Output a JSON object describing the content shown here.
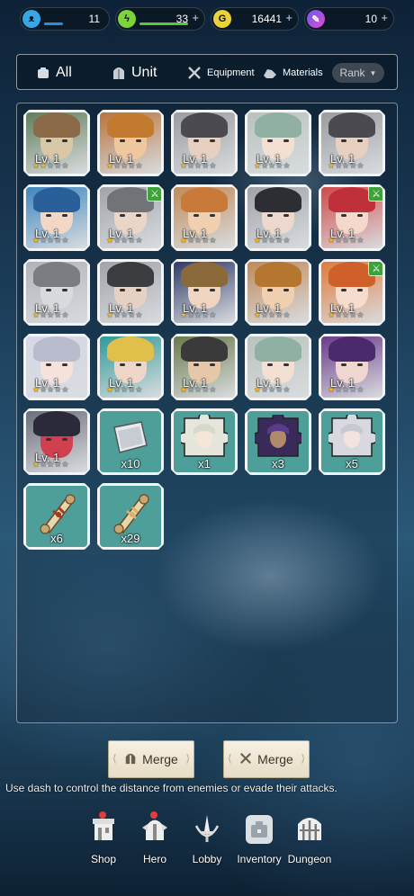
{
  "resources": [
    {
      "name": "stamina",
      "icon": "bear-icon",
      "value": "11",
      "color": "#37a6e6",
      "fill": 0.35
    },
    {
      "name": "energy",
      "icon": "lightning-icon",
      "value": "33",
      "plus": "+",
      "color": "#7dd33a",
      "fill": 0.9
    },
    {
      "name": "gold",
      "icon": "gold-coin-icon",
      "icon_letter": "G",
      "value": "16441",
      "plus": "+",
      "color": "#e8d33a"
    },
    {
      "name": "crystal",
      "icon": "feather-icon",
      "value": "10",
      "plus": "+",
      "color": "#c04de6"
    }
  ],
  "filters": {
    "all": "All",
    "unit": "Unit",
    "equipment": "Equipment",
    "materials": "Materials",
    "rank": "Rank"
  },
  "items": [
    {
      "kind": "unit",
      "lv": "Lv. 1",
      "stars": 2,
      "palette": [
        "#5f7f5a",
        "#d8c8a8",
        "#8b6a4a"
      ]
    },
    {
      "kind": "unit",
      "lv": "Lv. 1",
      "stars": 1,
      "palette": [
        "#b8743c",
        "#f0c8a0",
        "#c27a2e"
      ]
    },
    {
      "kind": "unit",
      "lv": "Lv. 1",
      "stars": 1,
      "palette": [
        "#9a9ca0",
        "#e8d0c0",
        "#4a4a50"
      ]
    },
    {
      "kind": "unit",
      "lv": "Lv. 1",
      "stars": 1,
      "palette": [
        "#b9c2bd",
        "#f3e0d2",
        "#8fb0a2"
      ]
    },
    {
      "kind": "unit",
      "lv": "Lv. 1",
      "stars": 1,
      "palette": [
        "#9a9ca0",
        "#e8d0c0",
        "#4a4a50"
      ]
    },
    {
      "kind": "unit",
      "lv": "Lv. 1",
      "stars": 1,
      "palette": [
        "#3e86c0",
        "#f2d6c6",
        "#2a5f9a"
      ]
    },
    {
      "kind": "unit",
      "lv": "Lv. 1",
      "stars": 1,
      "badge": true,
      "palette": [
        "#a0a3a8",
        "#ead6c8",
        "#707378"
      ]
    },
    {
      "kind": "unit",
      "lv": "Lv. 1",
      "stars": 1,
      "palette": [
        "#c08a5a",
        "#f0d0b0",
        "#c97a3a"
      ]
    },
    {
      "kind": "unit",
      "lv": "Lv. 1",
      "stars": 1,
      "palette": [
        "#9fa3a8",
        "#ecd8cc",
        "#2d2e33"
      ]
    },
    {
      "kind": "unit",
      "lv": "Lv. 1",
      "stars": 1,
      "badge": true,
      "palette": [
        "#d04a4a",
        "#f5d8cc",
        "#c0303a"
      ]
    },
    {
      "kind": "unit",
      "lv": "Lv. 1",
      "stars": 1,
      "palette": [
        "#b0b3b8",
        "#d8dade",
        "#7a7d82"
      ]
    },
    {
      "kind": "unit",
      "lv": "Lv. 1",
      "stars": 1,
      "palette": [
        "#a0a3a8",
        "#e6d2c4",
        "#3b3c40"
      ]
    },
    {
      "kind": "unit",
      "lv": "Lv. 1",
      "stars": 1,
      "palette": [
        "#2e3a6a",
        "#f0d6c0",
        "#8a6a3a"
      ]
    },
    {
      "kind": "unit",
      "lv": "Lv. 1",
      "stars": 1,
      "palette": [
        "#c08a5a",
        "#f0d0b0",
        "#b5762f"
      ]
    },
    {
      "kind": "unit",
      "lv": "Lv. 1",
      "stars": 1,
      "badge": true,
      "palette": [
        "#e07a3a",
        "#f5dccc",
        "#d0602a"
      ]
    },
    {
      "kind": "unit",
      "lv": "Lv. 1",
      "stars": 1,
      "palette": [
        "#d6d8e6",
        "#f5e2dc",
        "#b8bccc"
      ]
    },
    {
      "kind": "unit",
      "lv": "Lv. 1",
      "stars": 1,
      "palette": [
        "#2f9a9a",
        "#f0d6c8",
        "#e0c04a"
      ]
    },
    {
      "kind": "unit",
      "lv": "Lv. 1",
      "stars": 1,
      "palette": [
        "#6a7a4a",
        "#e6c8a8",
        "#3a3a3a"
      ]
    },
    {
      "kind": "unit",
      "lv": "Lv. 1",
      "stars": 1,
      "palette": [
        "#b9c2bd",
        "#f3e0d2",
        "#8fb0a2"
      ]
    },
    {
      "kind": "unit",
      "lv": "Lv. 1",
      "stars": 1,
      "palette": [
        "#6a3a8a",
        "#f0d6d0",
        "#4a2a6a"
      ]
    },
    {
      "kind": "unit",
      "lv": "Lv. 1",
      "stars": 1,
      "palette": [
        "#6a6e78",
        "#d04050",
        "#2a2a3a"
      ]
    },
    {
      "kind": "material",
      "qty": "x10",
      "icon": "metal-plate-icon"
    },
    {
      "kind": "material",
      "qty": "x1",
      "icon": "puzzle-piece-icon",
      "palette": [
        "#e6e6dc",
        "#f4e6d8",
        "#d8d8cc"
      ]
    },
    {
      "kind": "material",
      "qty": "x3",
      "icon": "puzzle-piece-icon",
      "palette": [
        "#3a2a5a",
        "#b08a6a",
        "#5a3a8a"
      ]
    },
    {
      "kind": "material",
      "qty": "x5",
      "icon": "puzzle-piece-icon",
      "palette": [
        "#d8d8e0",
        "#f4e2dc",
        "#c8c8d0"
      ]
    },
    {
      "kind": "material",
      "qty": "x6",
      "icon": "scroll-icon",
      "ribbon": "#a03a20"
    },
    {
      "kind": "material",
      "qty": "x29",
      "icon": "scroll-icon",
      "ribbon": "#d8b070"
    }
  ],
  "merge_buttons": [
    {
      "label": "Merge",
      "icon": "helmet-icon"
    },
    {
      "label": "Merge",
      "icon": "crossed-swords-icon"
    }
  ],
  "tip": "Use dash to control the distance from enemies or evade their attacks.",
  "nav": [
    {
      "label": "Shop",
      "icon": "shop-icon",
      "dot": true
    },
    {
      "label": "Hero",
      "icon": "hero-helmet-icon",
      "dot": true
    },
    {
      "label": "Lobby",
      "icon": "sword-emblem-icon"
    },
    {
      "label": "Inventory",
      "icon": "inventory-icon",
      "active": true
    },
    {
      "label": "Dungeon",
      "icon": "dungeon-gate-icon"
    }
  ]
}
